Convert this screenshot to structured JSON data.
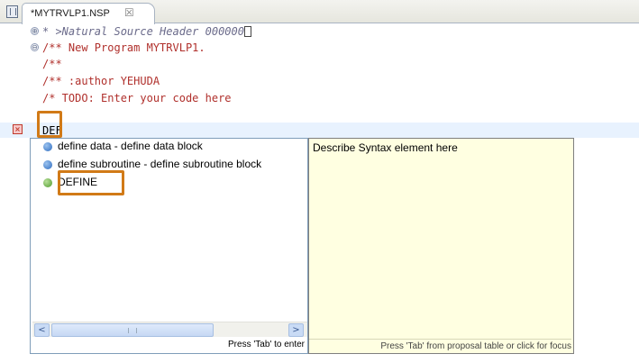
{
  "tab": {
    "title": "*MYTRVLP1.NSP",
    "close_glyph": "☒"
  },
  "code": {
    "lines": [
      "* >Natural Source Header 000000",
      "/** New Program MYTRVLP1.",
      "/**",
      "/** :author YEHUDA",
      "/* TODO: Enter your code here",
      "DEF"
    ],
    "fold_glyphs": [
      "⊕",
      "⊖"
    ]
  },
  "content_assist": {
    "proposals": [
      {
        "label": "define data - define data block",
        "icon": "blue-circle-icon"
      },
      {
        "label": "define subroutine - define subroutine block",
        "icon": "blue-circle-icon"
      },
      {
        "label": "DEFINE",
        "icon": "green-circle-icon"
      }
    ],
    "status": "Press 'Tab' to enter",
    "scroll_left": "<",
    "scroll_right": ">"
  },
  "info_popup": {
    "text": "Describe Syntax element here",
    "status": "Press 'Tab' from proposal table or click for focus"
  },
  "colors": {
    "highlight_box": "#d17a17",
    "current_line": "#e8f2fe",
    "info_background": "#ffffe1"
  }
}
